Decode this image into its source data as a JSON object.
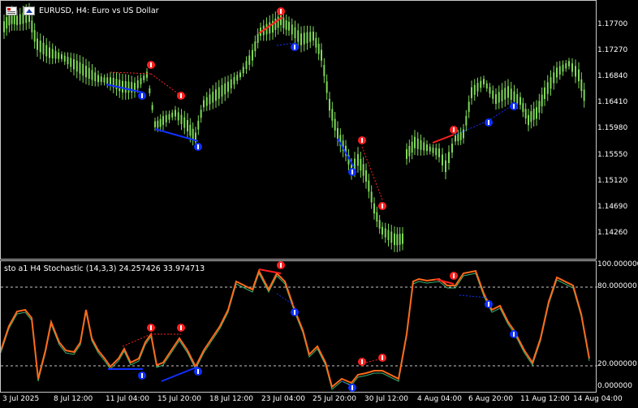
{
  "symbol_title": "EURUSD, H4:  Euro vs US Dollar",
  "indicator_title": "sto a1 H4  Stochastic (14,3,3) 24.257426 33.974713",
  "colors": {
    "bull_candle": "#7ed957",
    "stoch_main": "#ff6a1a",
    "stoch_signal": "#3cb371",
    "divergence_bear": "#ff2020",
    "divergence_bull": "#1030ff",
    "level_line": "#c8c8c8"
  },
  "price_axis": [
    "1.17700",
    "1.17270",
    "1.16840",
    "1.16410",
    "1.15980",
    "1.15550",
    "1.15120",
    "1.14690",
    "1.14260"
  ],
  "stoch_axis": [
    "100.000000",
    "80.000000",
    "20.000000",
    "0.000000"
  ],
  "time_axis": [
    "3 Jul 2025",
    "8 Jul 12:00",
    "11 Jul 04:00",
    "15 Jul 20:00",
    "18 Jul 12:00",
    "23 Jul 04:00",
    "25 Jul 20:00",
    "30 Jul 12:00",
    "4 Aug 04:00",
    "6 Aug 20:00",
    "11 Aug 12:00",
    "14 Aug 04:00"
  ],
  "icons": {
    "chart_icon": "chart-window-icon",
    "arrow_up": "arrow-up-icon",
    "arrow_down": "arrow-down-icon"
  }
}
